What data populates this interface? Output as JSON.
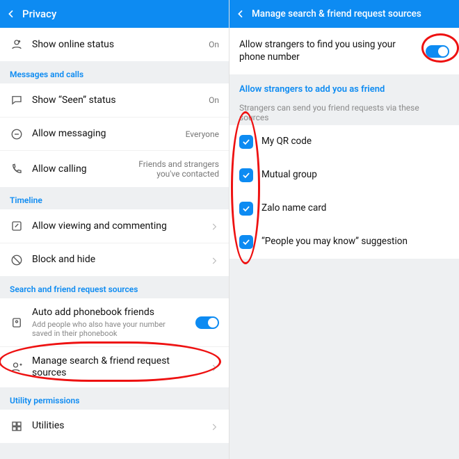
{
  "left": {
    "title": "Privacy",
    "rows": {
      "online": {
        "label": "Show online status",
        "value": "On"
      }
    },
    "sections": {
      "messages": {
        "title": "Messages and calls",
        "seen": {
          "label": "Show “Seen” status",
          "value": "On"
        },
        "messaging": {
          "label": "Allow messaging",
          "value": "Everyone"
        },
        "calling": {
          "label": "Allow calling",
          "value": "Friends and strangers you've contacted"
        }
      },
      "timeline": {
        "title": "Timeline",
        "viewing": {
          "label": "Allow viewing and commenting"
        },
        "block": {
          "label": "Block and hide"
        }
      },
      "search": {
        "title": "Search and friend request sources",
        "autoadd": {
          "label": "Auto add phonebook friends",
          "sub": "Add people who also have your number saved in their phonebook"
        },
        "manage": {
          "label": "Manage search & friend request sources"
        }
      },
      "utility": {
        "title": "Utility permissions",
        "utilities": {
          "label": "Utilities"
        }
      }
    }
  },
  "right": {
    "title": "Manage search & friend request sources",
    "allow_find": {
      "label": "Allow strangers to find you using your phone number"
    },
    "section_title": "Allow strangers to add you as friend",
    "hint": "Strangers can send you friend requests via these sources",
    "sources": [
      {
        "label": "My QR code"
      },
      {
        "label": "Mutual group"
      },
      {
        "label": "Zalo name card"
      },
      {
        "label": "“People you may know” suggestion"
      }
    ]
  }
}
